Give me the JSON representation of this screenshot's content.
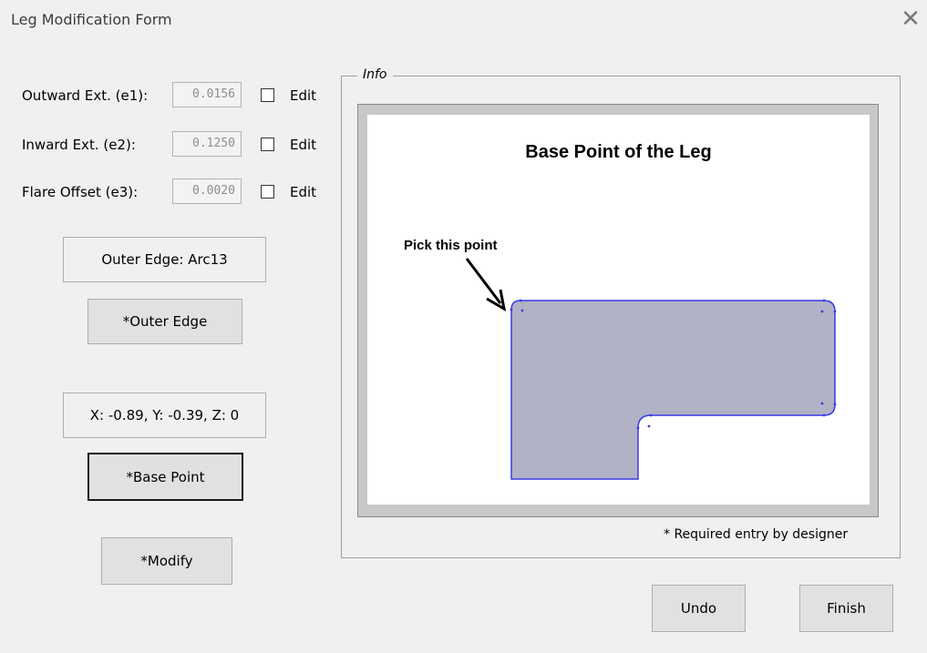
{
  "window": {
    "title": "Leg Modification Form",
    "close_glyph": "✕"
  },
  "fields": [
    {
      "label": "Outward Ext. (e1):",
      "value": "0.0156",
      "checkbox_label": "Edit",
      "checked": false
    },
    {
      "label": "Inward Ext. (e2):",
      "value": "0.1250",
      "checkbox_label": "Edit",
      "checked": false
    },
    {
      "label": "Flare Offset (e3):",
      "value": "0.0020",
      "checkbox_label": "Edit",
      "checked": false
    }
  ],
  "outer_edge": {
    "display": "Outer Edge: Arc13",
    "button": "*Outer Edge"
  },
  "base_point": {
    "display": "X: -0.89, Y: -0.39, Z: 0",
    "button": "*Base Point"
  },
  "modify_button": "*Modify",
  "info": {
    "legend": "Info",
    "picture_title": "Base Point of the Leg",
    "pick_label": "Pick this point",
    "required_note": "* Required entry by designer",
    "shape_fill": "#b1b2c5",
    "shape_stroke": "#3a3ae8"
  },
  "undo_button": "Undo",
  "finish_button": "Finish"
}
